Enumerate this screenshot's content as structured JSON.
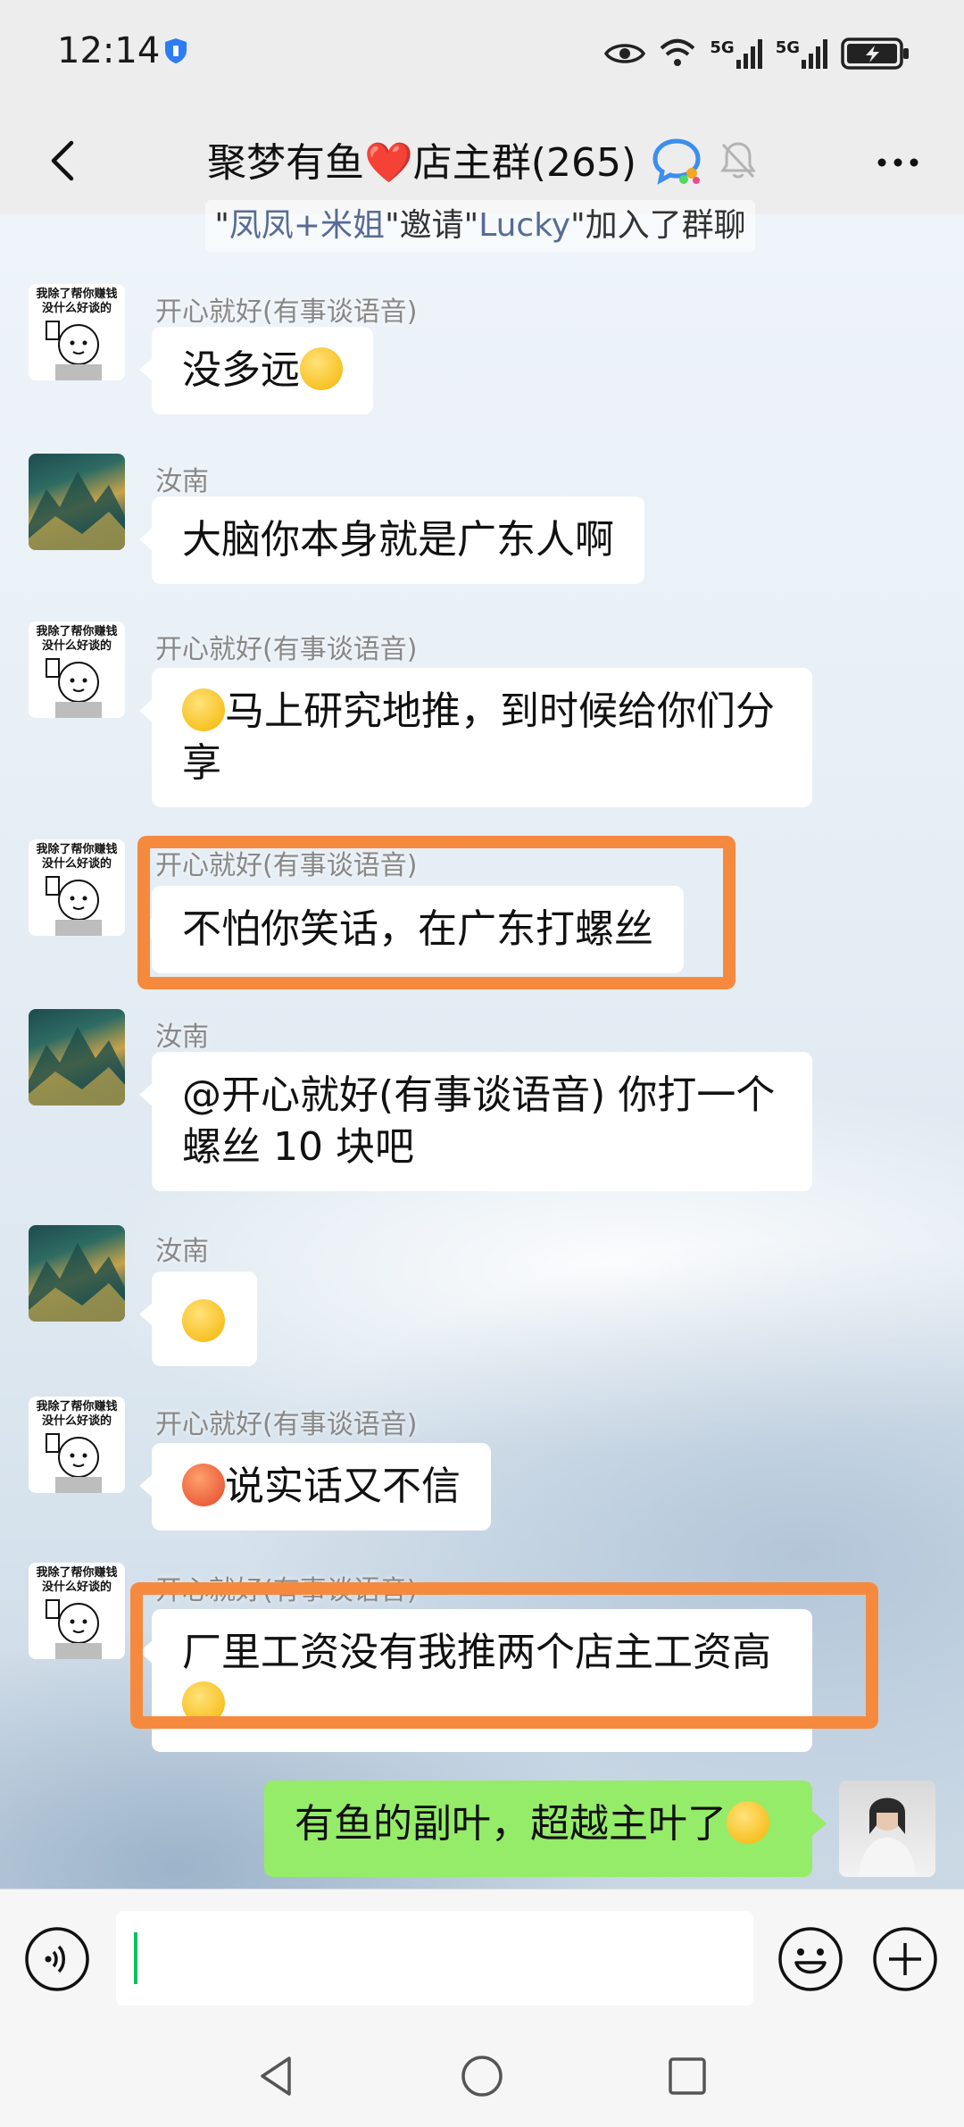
{
  "status_bar": {
    "time": "12:14",
    "signal_1_label": "5G",
    "signal_2_label": "5G"
  },
  "header": {
    "title": "聚梦有鱼❤️店主群(265)",
    "icons": [
      "back-arrow-icon",
      "chat-bubble-icon",
      "mute-bell-icon",
      "more-icon"
    ]
  },
  "system_message": {
    "prefix": "\"",
    "inviter": "凤凤+米姐",
    "middle": "\"邀请\"",
    "invitee": "Lucky",
    "suffix": "\"加入了群聊"
  },
  "messages": [
    {
      "sender": "开心就好(有事谈语音)",
      "text": "没多远",
      "emoji": "thinking-face-emoji"
    },
    {
      "sender": "汝南",
      "text": "大脑你本身就是广东人啊"
    },
    {
      "sender": "开心就好(有事谈语音)",
      "emoji": "sunglasses-face-emoji",
      "line1": "马上研究地推，到时候给你们分",
      "line2": "享"
    },
    {
      "sender": "开心就好(有事谈语音)",
      "text": "不怕你笑话，在广东打螺丝"
    },
    {
      "sender": "汝南",
      "line1": "@开心就好(有事谈语音) 你打一个",
      "line2": "螺丝 10 块吧"
    },
    {
      "sender": "汝南",
      "emoji": "crying-laughing-emoji"
    },
    {
      "sender": "开心就好(有事谈语音)",
      "emoji": "angry-face-emoji",
      "text": "说实话又不信"
    },
    {
      "sender": "开心就好(有事谈语音)",
      "text": "厂里工资没有我推两个店主工资高",
      "emoji": "grinning-face-emoji"
    },
    {
      "sender": "self",
      "text": "有鱼的副叶，超越主叶了",
      "emoji": "grinning-face-emoji"
    }
  ],
  "meme_avatar_text": {
    "line1": "我除了帮你赚钱",
    "line2": "没什么好谈的"
  },
  "input_bar": {
    "value": "",
    "placeholder": ""
  },
  "colors": {
    "highlight_border": "#f58a3f",
    "self_bubble": "#95ec69",
    "cursor": "#07c160"
  }
}
